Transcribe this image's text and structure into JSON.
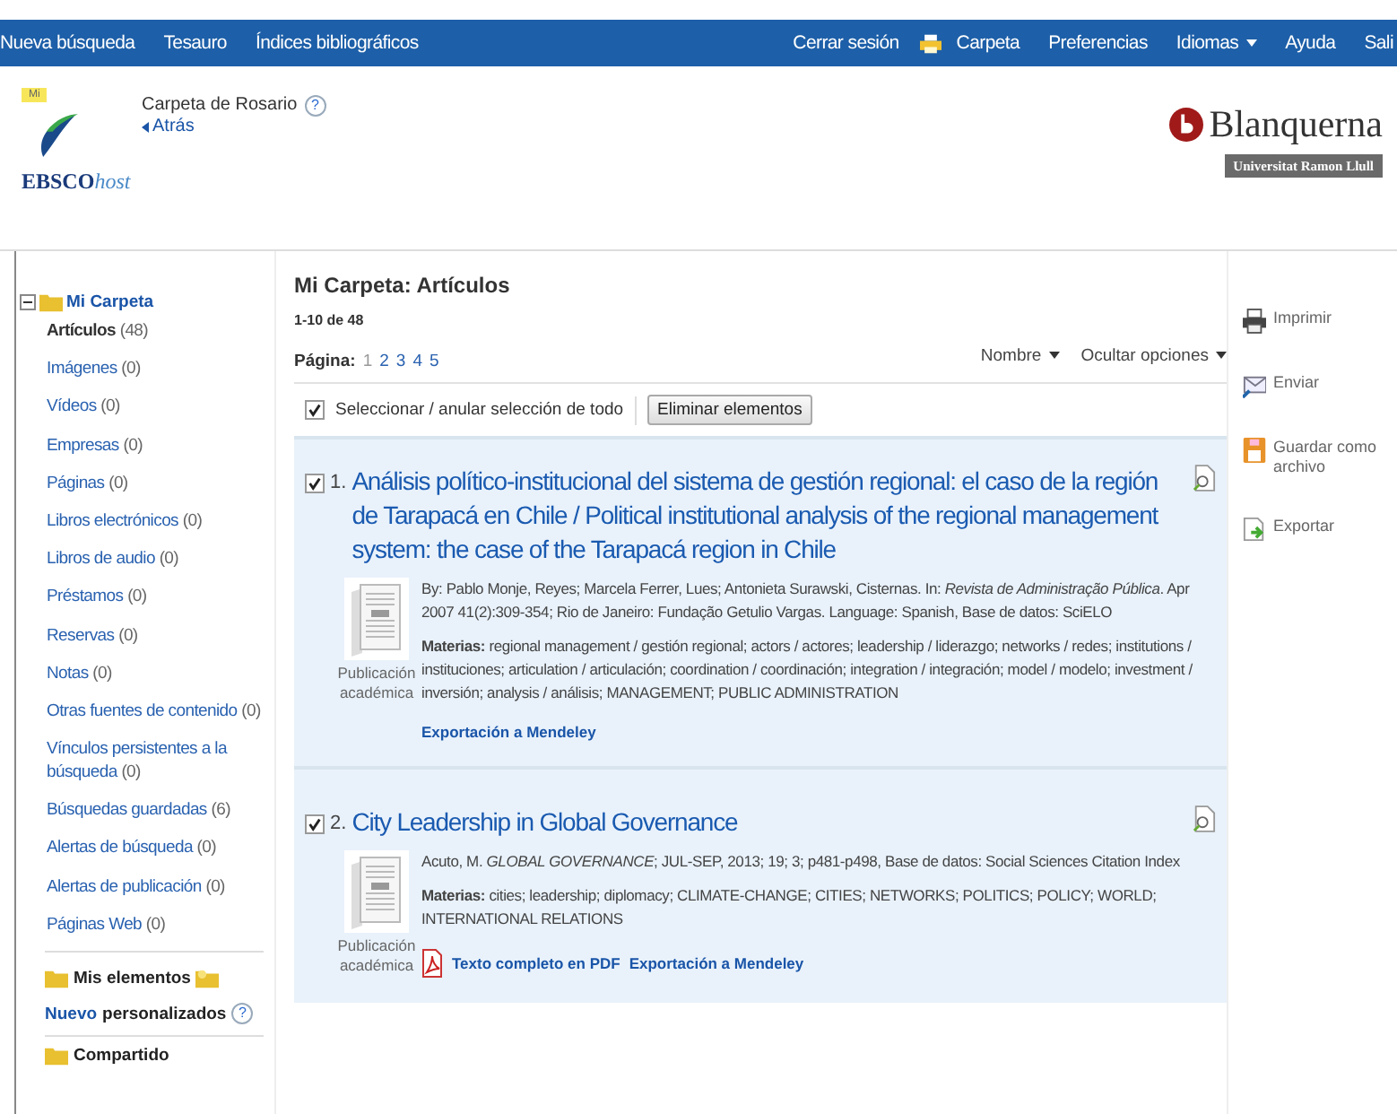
{
  "top_nav": {
    "left": [
      {
        "label": "Nueva búsqueda"
      },
      {
        "label": "Tesauro"
      },
      {
        "label": "Índices bibliográficos"
      }
    ],
    "right": [
      {
        "label": "Cerrar sesión",
        "kind": "plain"
      },
      {
        "label": "Carpeta",
        "kind": "folder"
      },
      {
        "label": "Preferencias",
        "kind": "plain"
      },
      {
        "label": "Idiomas",
        "kind": "menu"
      },
      {
        "label": "Ayuda",
        "kind": "plain"
      },
      {
        "label": "Sali",
        "kind": "plain"
      }
    ]
  },
  "header": {
    "badge": "Mi",
    "logo_text": "EBSCO",
    "logo_italic": "host",
    "folder_title": "Carpeta de Rosario",
    "help": "?",
    "back": "Atrás",
    "brand": "Blanquerna",
    "brand_sub": "Universitat Ramon Llull"
  },
  "sidebar": {
    "title": "Mi Carpeta",
    "expanded": true,
    "items": [
      {
        "label": "Artículos",
        "count": "(48)",
        "selected": true
      },
      {
        "label": "Imágenes",
        "count": "(0)",
        "selected": false
      },
      {
        "label": "Vídeos",
        "count": "(0)",
        "selected": false
      },
      {
        "label": "Empresas",
        "count": "(0)",
        "selected": false
      },
      {
        "label": "Páginas",
        "count": "(0)",
        "selected": false
      },
      {
        "label": "Libros electrónicos",
        "count": "(0)",
        "selected": false
      },
      {
        "label": "Libros de audio",
        "count": "(0)",
        "selected": false
      },
      {
        "label": "Préstamos",
        "count": "(0)",
        "selected": false
      },
      {
        "label": "Reservas",
        "count": "(0)",
        "selected": false
      },
      {
        "label": "Notas",
        "count": "(0)",
        "selected": false
      },
      {
        "label": "Otras fuentes de contenido",
        "count": "(0)",
        "selected": false
      },
      {
        "label": "Vínculos persistentes a la búsqueda",
        "count": "(0)",
        "selected": false
      },
      {
        "label": "Búsquedas guardadas",
        "count": "(6)",
        "selected": false
      },
      {
        "label": "Alertas de búsqueda",
        "count": "(0)",
        "selected": false
      },
      {
        "label": "Alertas de publicación",
        "count": "(0)",
        "selected": false
      },
      {
        "label": "Páginas Web",
        "count": "(0)",
        "selected": false
      }
    ],
    "custom_title_1": "Mis elementos",
    "custom_new": "Nuevo",
    "custom_title_2": "personalizados",
    "custom_help": "?",
    "shared_title": "Compartido"
  },
  "main": {
    "title": "Mi Carpeta: Artículos",
    "range": "1-10 de 48",
    "page_label": "Página:",
    "pages": [
      {
        "label": "1",
        "selected": true
      },
      {
        "label": "2",
        "selected": false
      },
      {
        "label": "3",
        "selected": false
      },
      {
        "label": "4",
        "selected": false
      },
      {
        "label": "5",
        "selected": false
      }
    ],
    "sort": "Nombre",
    "options": "Ocultar opciones",
    "select_all": {
      "label": "Seleccionar / anular selección de todo",
      "checked": true
    },
    "delete_button": "Eliminar elementos",
    "results": [
      {
        "number": "1.",
        "checked": true,
        "title": "Análisis político-institucional del sistema de gestión regional: el caso de la región de Tarapacá en Chile / Political institutional analysis of the regional management system: the case of the Tarapacá region in Chile",
        "type_1": "Publicación",
        "type_2": "académica",
        "details": "By: Pablo Monje, Reyes; Marcela Ferrer, Lues; Antonieta Surawski, Cisternas. In: *Revista de Administração Pública*. Apr 2007 41(2):309-354; Rio de Janeiro: Fundação Getulio Vargas. Language: Spanish, Base de datos: SciELO",
        "subjects": "**Materias:** regional management / gestión regional; actors / actores; leadership / liderazgo; networks / redes; institutions / instituciones; articulation / articulación; coordination / coordinación; integration / integración; model / modelo; investment / inversión; analysis / análisis; MANAGEMENT; PUBLIC ADMINISTRATION",
        "links": [
          {
            "kind": "export",
            "label": "Exportación a Mendeley"
          }
        ]
      },
      {
        "number": "2.",
        "checked": true,
        "title": "City Leadership in Global Governance",
        "type_1": "Publicación",
        "type_2": "académica",
        "details": "Acuto, M. *GLOBAL GOVERNANCE*; JUL-SEP, 2013; 19; 3; p481-p498, Base de datos: Social Sciences Citation Index",
        "subjects": "**Materias:** cities; leadership; diplomacy; CLIMATE-CHANGE; CITIES; NETWORKS; POLITICS; POLICY; WORLD; INTERNATIONAL RELATIONS",
        "links": [
          {
            "kind": "pdf",
            "label": "Texto completo en PDF"
          },
          {
            "kind": "export",
            "label": "Exportación a Mendeley"
          }
        ]
      }
    ]
  },
  "tools": [
    {
      "kind": "print",
      "label": "Imprimir"
    },
    {
      "kind": "mail",
      "label": "Enviar"
    },
    {
      "kind": "save",
      "label": "Guardar como archivo"
    },
    {
      "kind": "export",
      "label": "Exportar"
    }
  ]
}
